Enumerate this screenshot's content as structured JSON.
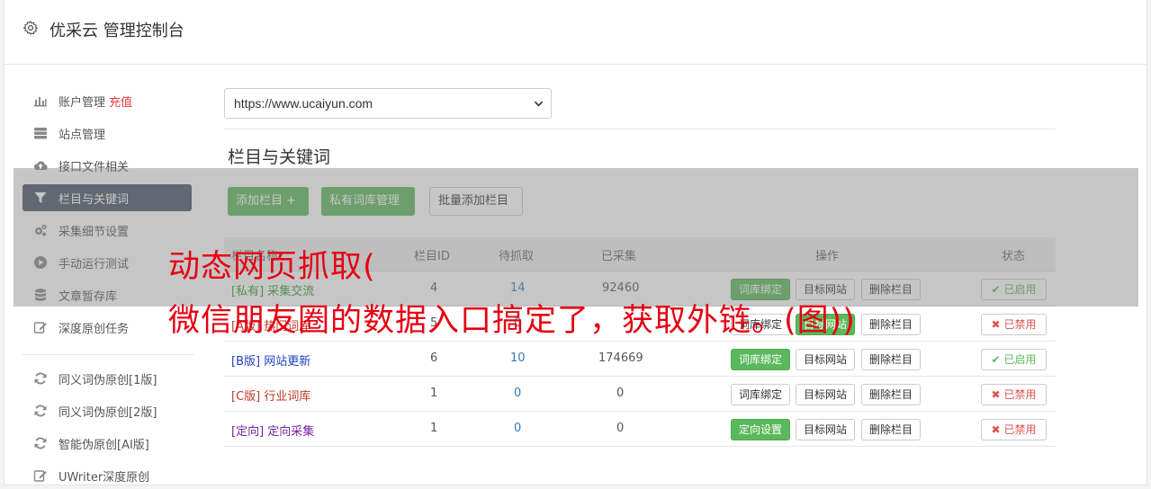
{
  "app": {
    "title": "优采云 管理控制台"
  },
  "sidebar": {
    "items": [
      {
        "label": "账户管理",
        "badge": "充值",
        "icon": "bar-chart-icon"
      },
      {
        "label": "站点管理",
        "icon": "server-icon"
      },
      {
        "label": "接口文件相关",
        "icon": "cloud-upload-icon"
      },
      {
        "label": "栏目与关键词",
        "icon": "filter-icon",
        "active": true
      },
      {
        "label": "采集细节设置",
        "icon": "cogs-icon"
      },
      {
        "label": "手动运行测试",
        "icon": "play-circle-icon"
      },
      {
        "label": "文章暂存库",
        "icon": "database-icon"
      },
      {
        "label": "深度原创任务",
        "icon": "edit-icon"
      },
      {
        "label": "同义词伪原创[1版]",
        "icon": "refresh-icon"
      },
      {
        "label": "同义词伪原创[2版]",
        "icon": "refresh-icon"
      },
      {
        "label": "智能伪原创[AI版]",
        "icon": "refresh-icon"
      },
      {
        "label": "UWriter深度原创",
        "icon": "edit-icon"
      }
    ]
  },
  "site_select": {
    "value": "https://www.ucaiyun.com"
  },
  "section": {
    "title": "栏目与关键词"
  },
  "toolbar": {
    "add_column": "添加栏目 +",
    "private_lib": "私有词库管理",
    "batch_add": "批量添加栏目"
  },
  "table": {
    "headers": {
      "name": "栏目名称",
      "id": "栏目ID",
      "pending": "待抓取",
      "collected": "已采集",
      "ops": "操作",
      "status": "状态"
    },
    "rows": [
      {
        "tag": "[私有]",
        "name": "采集交流",
        "id": "4",
        "pending": "14",
        "collected": "92460",
        "op1": "词库绑定",
        "op2": "目标网站",
        "op3": "删除栏目",
        "status": "已启用"
      },
      {
        "tag": "[A版]",
        "name": "热门词库",
        "id": "5",
        "pending": "0",
        "collected": "",
        "op1": "词库绑定",
        "op2": "目标网站",
        "op3": "删除栏目",
        "status": "已禁用"
      },
      {
        "tag": "[B版]",
        "name": "网站更新",
        "id": "6",
        "pending": "10",
        "collected": "174669",
        "op1": "词库绑定",
        "op2": "目标网站",
        "op3": "删除栏目",
        "status": "已启用"
      },
      {
        "tag": "[C版]",
        "name": "行业词库",
        "id": "1",
        "pending": "0",
        "collected": "0",
        "op1": "词库绑定",
        "op2": "目标网站",
        "op3": "删除栏目",
        "status": "已禁用"
      },
      {
        "tag": "[定向]",
        "name": "定向采集",
        "id": "1",
        "pending": "0",
        "collected": "0",
        "op1": "定向设置",
        "op2": "目标网站",
        "op3": "删除栏目",
        "status": "已禁用"
      }
    ]
  },
  "watermark": {
    "line1": "动态网页抓取(",
    "line2": "微信朋友圈的数据入口搞定了，获取外链。(图))"
  },
  "colors": {
    "accent_green": "#5cb85c",
    "sidebar_active": "#4a5566",
    "link_blue": "#337ab7",
    "watermark_red": "#e60012"
  }
}
